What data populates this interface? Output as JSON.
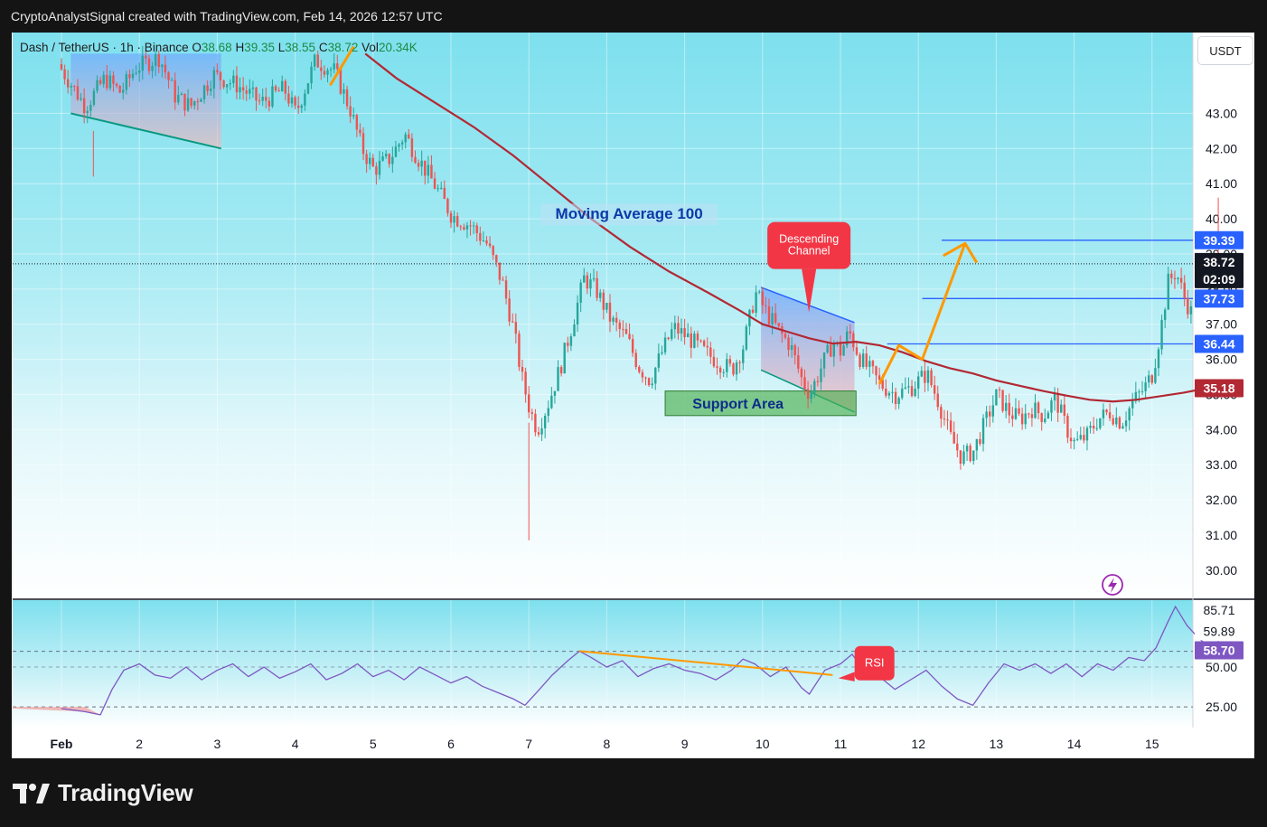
{
  "header": {
    "attribution": "CryptoAnalystSignal created with TradingView.com, Feb 14, 2026 12:57 UTC"
  },
  "legend": {
    "symbol": "Dash / TetherUS · 1h · Binance",
    "open_label": "O",
    "open": "38.68",
    "high_label": "H",
    "high": "39.35",
    "low_label": "L",
    "low": "38.55",
    "close_label": "C",
    "close": "38.72",
    "vol_label": "Vol",
    "vol": "20.34K"
  },
  "currency_button": "USDT",
  "annotations": {
    "ma_label": "Moving Average 100",
    "channel_label_1": "Descending",
    "channel_label_2": "Channel",
    "support_label": "Support Area",
    "rsi_label": "RSI"
  },
  "price_badges": [
    {
      "value": "39.39",
      "color": "#2962ff"
    },
    {
      "value": "38.72",
      "color": "#131722"
    },
    {
      "value": "02:09",
      "color": "#131722"
    },
    {
      "value": "37.73",
      "color": "#2962ff"
    },
    {
      "value": "36.44",
      "color": "#2962ff"
    },
    {
      "value": "35.18",
      "color": "#b22833"
    }
  ],
  "rsi_badges": [
    {
      "value": "85.71",
      "color": "#ffffff"
    },
    {
      "value": "59.89",
      "color": "#ffffff"
    },
    {
      "value": "58.70",
      "color": "#7e57c2"
    }
  ],
  "brand": "TradingView",
  "colors": {
    "bull": "#26a69a",
    "bear": "#ef5350",
    "ma": "#b22833",
    "line_blue": "#2962ff",
    "orange": "#ff9800",
    "rsi": "#7e57c2",
    "callout_red": "#f23645",
    "support_green": "#4caf50"
  },
  "chart_data": {
    "type": "candlestick",
    "title": "",
    "xlabel": "",
    "ylabel": "",
    "ylim": [
      29.2,
      45.3
    ],
    "y_ticks": [
      30,
      31,
      32,
      33,
      34,
      35,
      36,
      37,
      38,
      39,
      40,
      41,
      42,
      43
    ],
    "x_tick_labels": [
      "Feb",
      "2",
      "3",
      "4",
      "5",
      "6",
      "7",
      "8",
      "9",
      "10",
      "11",
      "12",
      "13",
      "14",
      "15"
    ],
    "x_start": 0.0,
    "x_end": 15.45,
    "grid": true,
    "price_path": [
      [
        0.0,
        44.4
      ],
      [
        0.35,
        43.2
      ],
      [
        0.6,
        44.0
      ],
      [
        0.8,
        43.6
      ],
      [
        1.0,
        44.3
      ],
      [
        1.3,
        44.6
      ],
      [
        1.5,
        43.5
      ],
      [
        1.7,
        43.2
      ],
      [
        2.0,
        44.1
      ],
      [
        2.3,
        43.8
      ],
      [
        2.6,
        43.3
      ],
      [
        2.9,
        43.7
      ],
      [
        3.05,
        43.0
      ],
      [
        3.3,
        44.5
      ],
      [
        3.55,
        44.2
      ],
      [
        3.75,
        43.1
      ],
      [
        3.9,
        42.0
      ],
      [
        4.05,
        41.4
      ],
      [
        4.25,
        41.7
      ],
      [
        4.45,
        42.4
      ],
      [
        4.6,
        41.8
      ],
      [
        4.85,
        40.9
      ],
      [
        5.05,
        40.1
      ],
      [
        5.3,
        39.8
      ],
      [
        5.5,
        39.3
      ],
      [
        5.7,
        38.2
      ],
      [
        5.85,
        36.8
      ],
      [
        5.95,
        35.5
      ],
      [
        6.05,
        34.6
      ],
      [
        6.15,
        34.0
      ],
      [
        6.3,
        34.8
      ],
      [
        6.45,
        35.8
      ],
      [
        6.6,
        37.0
      ],
      [
        6.75,
        38.3
      ],
      [
        6.9,
        38.0
      ],
      [
        7.1,
        37.1
      ],
      [
        7.3,
        36.6
      ],
      [
        7.45,
        35.8
      ],
      [
        7.6,
        35.4
      ],
      [
        7.75,
        36.2
      ],
      [
        7.9,
        36.9
      ],
      [
        8.1,
        36.6
      ],
      [
        8.3,
        36.2
      ],
      [
        8.5,
        35.9
      ],
      [
        8.65,
        35.7
      ],
      [
        8.8,
        36.4
      ],
      [
        8.95,
        37.9
      ],
      [
        9.1,
        37.3
      ],
      [
        9.25,
        36.8
      ],
      [
        9.4,
        36.4
      ],
      [
        9.55,
        35.4
      ],
      [
        9.65,
        35.0
      ],
      [
        9.8,
        35.8
      ],
      [
        9.95,
        36.5
      ],
      [
        10.05,
        36.2
      ],
      [
        10.15,
        36.8
      ],
      [
        10.3,
        36.0
      ],
      [
        10.45,
        35.6
      ],
      [
        10.55,
        35.3
      ],
      [
        10.75,
        35.0
      ],
      [
        10.95,
        35.2
      ],
      [
        11.15,
        35.6
      ],
      [
        11.3,
        34.8
      ],
      [
        11.45,
        33.8
      ],
      [
        11.6,
        33.2
      ],
      [
        11.75,
        33.4
      ],
      [
        11.9,
        34.2
      ],
      [
        12.05,
        35.0
      ],
      [
        12.2,
        34.5
      ],
      [
        12.35,
        34.3
      ],
      [
        12.5,
        34.6
      ],
      [
        12.65,
        34.4
      ],
      [
        12.8,
        34.9
      ],
      [
        12.95,
        34.0
      ],
      [
        13.05,
        33.6
      ],
      [
        13.2,
        33.8
      ],
      [
        13.35,
        34.3
      ],
      [
        13.5,
        34.5
      ],
      [
        13.65,
        34.2
      ],
      [
        13.8,
        34.8
      ],
      [
        13.95,
        35.2
      ],
      [
        14.05,
        35.6
      ],
      [
        14.15,
        36.8
      ],
      [
        14.25,
        38.2
      ],
      [
        14.35,
        38.5
      ],
      [
        14.45,
        37.8
      ],
      [
        14.55,
        37.3
      ],
      [
        14.65,
        37.9
      ],
      [
        14.75,
        38.3
      ],
      [
        14.82,
        39.9
      ],
      [
        14.9,
        39.2
      ],
      [
        14.97,
        38.72
      ]
    ],
    "moving_average_100": [
      [
        3.9,
        44.7
      ],
      [
        4.3,
        44.0
      ],
      [
        4.8,
        43.3
      ],
      [
        5.3,
        42.6
      ],
      [
        5.8,
        41.8
      ],
      [
        6.3,
        40.9
      ],
      [
        6.8,
        40.0
      ],
      [
        7.3,
        39.2
      ],
      [
        7.8,
        38.5
      ],
      [
        8.3,
        37.9
      ],
      [
        8.7,
        37.4
      ],
      [
        9.0,
        37.0
      ],
      [
        9.3,
        36.8
      ],
      [
        9.6,
        36.6
      ],
      [
        9.9,
        36.45
      ],
      [
        10.2,
        36.5
      ],
      [
        10.5,
        36.4
      ],
      [
        10.8,
        36.2
      ],
      [
        11.1,
        35.95
      ],
      [
        11.4,
        35.75
      ],
      [
        11.7,
        35.6
      ],
      [
        12.0,
        35.4
      ],
      [
        12.3,
        35.25
      ],
      [
        12.6,
        35.1
      ],
      [
        12.9,
        34.97
      ],
      [
        13.2,
        34.85
      ],
      [
        13.5,
        34.8
      ],
      [
        13.8,
        34.85
      ],
      [
        14.1,
        34.95
      ],
      [
        14.4,
        35.05
      ],
      [
        14.7,
        35.18
      ],
      [
        15.0,
        35.3
      ]
    ],
    "horizontal_levels": [
      39.39,
      37.73,
      36.44
    ],
    "current_price": 38.72,
    "rsi": {
      "ylim": [
        12,
        92
      ],
      "y_ticks": [
        25,
        50
      ],
      "upper_band": 59.89,
      "lower_band": 25.0,
      "last": 58.7,
      "max_shown": 85.71,
      "path": [
        [
          0.0,
          24
        ],
        [
          0.3,
          22
        ],
        [
          0.5,
          20
        ],
        [
          0.65,
          36
        ],
        [
          0.8,
          48
        ],
        [
          1.0,
          52
        ],
        [
          1.2,
          45
        ],
        [
          1.4,
          43
        ],
        [
          1.6,
          50
        ],
        [
          1.8,
          42
        ],
        [
          2.0,
          48
        ],
        [
          2.2,
          52
        ],
        [
          2.4,
          44
        ],
        [
          2.6,
          50
        ],
        [
          2.8,
          43
        ],
        [
          3.0,
          47
        ],
        [
          3.2,
          52
        ],
        [
          3.4,
          42
        ],
        [
          3.6,
          46
        ],
        [
          3.8,
          52
        ],
        [
          4.0,
          44
        ],
        [
          4.2,
          48
        ],
        [
          4.4,
          42
        ],
        [
          4.6,
          50
        ],
        [
          4.8,
          45
        ],
        [
          5.0,
          40
        ],
        [
          5.2,
          44
        ],
        [
          5.4,
          38
        ],
        [
          5.6,
          34
        ],
        [
          5.8,
          30
        ],
        [
          5.95,
          26
        ],
        [
          6.1,
          34
        ],
        [
          6.3,
          45
        ],
        [
          6.5,
          54
        ],
        [
          6.65,
          60
        ],
        [
          6.8,
          56
        ],
        [
          7.0,
          50
        ],
        [
          7.2,
          54
        ],
        [
          7.4,
          44
        ],
        [
          7.6,
          49
        ],
        [
          7.8,
          52
        ],
        [
          8.0,
          48
        ],
        [
          8.2,
          46
        ],
        [
          8.4,
          42
        ],
        [
          8.6,
          48
        ],
        [
          8.75,
          55
        ],
        [
          8.9,
          52
        ],
        [
          9.1,
          44
        ],
        [
          9.3,
          50
        ],
        [
          9.5,
          37
        ],
        [
          9.6,
          33
        ],
        [
          9.8,
          48
        ],
        [
          10.0,
          52
        ],
        [
          10.15,
          58
        ],
        [
          10.3,
          48
        ],
        [
          10.5,
          44
        ],
        [
          10.7,
          36
        ],
        [
          10.9,
          42
        ],
        [
          11.1,
          48
        ],
        [
          11.3,
          38
        ],
        [
          11.5,
          30
        ],
        [
          11.7,
          26
        ],
        [
          11.9,
          40
        ],
        [
          12.1,
          52
        ],
        [
          12.3,
          48
        ],
        [
          12.5,
          52
        ],
        [
          12.7,
          46
        ],
        [
          12.9,
          52
        ],
        [
          13.1,
          44
        ],
        [
          13.3,
          52
        ],
        [
          13.5,
          48
        ],
        [
          13.7,
          56
        ],
        [
          13.9,
          54
        ],
        [
          14.05,
          62
        ],
        [
          14.2,
          78
        ],
        [
          14.3,
          88
        ],
        [
          14.45,
          76
        ],
        [
          14.6,
          68
        ],
        [
          14.75,
          62
        ],
        [
          14.85,
          66
        ],
        [
          14.95,
          60
        ],
        [
          15.05,
          58.7
        ]
      ]
    }
  }
}
